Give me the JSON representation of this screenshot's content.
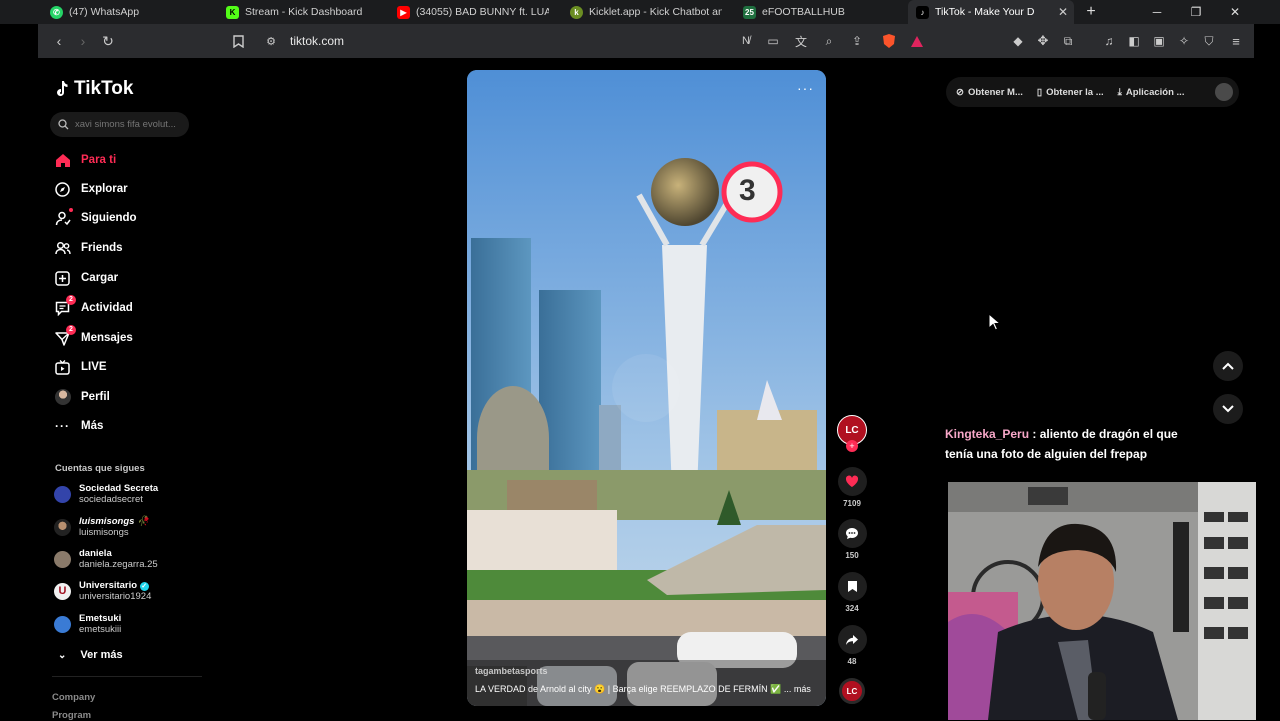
{
  "browser": {
    "tabs": [
      {
        "title": "(47) WhatsApp",
        "icon": "whatsapp-icon",
        "color": "#25d366"
      },
      {
        "title": "Stream - Kick Dashboard",
        "icon": "kick-icon",
        "color": "#53fc18"
      },
      {
        "title": "(34055) BAD BUNNY ft. LUAR",
        "icon": "youtube-icon",
        "color": "#ff0000"
      },
      {
        "title": "Kicklet.app - Kick Chatbot an",
        "icon": "kicklet-icon",
        "color": "#6b8e23"
      },
      {
        "title": "eFOOTBALLHUB",
        "icon": "efootballhub-icon",
        "color": "#1f6f3f",
        "glyph": "25"
      },
      {
        "title": "TikTok - Make Your D",
        "icon": "tiktok-icon",
        "color": "#000000"
      }
    ],
    "url": "tiktok.com"
  },
  "sidebar": {
    "logo": "TikTok",
    "search_placeholder": "xavi simons fifa evolut...",
    "nav": [
      {
        "label": "Para ti",
        "icon": "home-icon",
        "active": true
      },
      {
        "label": "Explorar",
        "icon": "compass-icon"
      },
      {
        "label": "Siguiendo",
        "icon": "following-icon"
      },
      {
        "label": "Friends",
        "icon": "friends-icon"
      },
      {
        "label": "Cargar",
        "icon": "upload-icon"
      },
      {
        "label": "Actividad",
        "icon": "activity-icon",
        "badge": "2"
      },
      {
        "label": "Mensajes",
        "icon": "messages-icon",
        "badge": "2"
      },
      {
        "label": "LIVE",
        "icon": "live-icon"
      },
      {
        "label": "Perfil",
        "icon": "profile-avatar"
      },
      {
        "label": "Más",
        "icon": "more-icon"
      }
    ],
    "following_title": "Cuentas que sigues",
    "following": [
      {
        "name": "Sociedad Secreta",
        "handle": "sociedadsecret",
        "color": "#3344aa"
      },
      {
        "name": "luismisongs 🥀",
        "handle": "luismisongs",
        "color": "#222222"
      },
      {
        "name": "daniela",
        "handle": "daniela.zegarra.25",
        "color": "#8a7a6a"
      },
      {
        "name": "Universitario",
        "handle": "universitario1924",
        "color": "#f0f0f0",
        "verified": true
      },
      {
        "name": "Emetsuki",
        "handle": "emetsukiii",
        "color": "#3a7bd5"
      }
    ],
    "see_more": "Ver más",
    "footer": [
      "Company",
      "Program"
    ]
  },
  "video": {
    "username": "tagambetasports",
    "description": "LA VERDAD de Arnold al city 😮 | Barça elige REEMPLAZO DE FERMÍN ✅ ... más",
    "badge_number": "3"
  },
  "actions": [
    {
      "name": "like",
      "icon": "heart-icon",
      "count": "7109"
    },
    {
      "name": "comment",
      "icon": "comment-icon",
      "count": "150"
    },
    {
      "name": "save",
      "icon": "bookmark-icon",
      "count": "324"
    },
    {
      "name": "share",
      "icon": "share-icon",
      "count": "48"
    }
  ],
  "topbar": {
    "items": [
      "Obtener M...",
      "Obtener la ...",
      "Aplicación ..."
    ]
  },
  "chat": {
    "user": "Kingteka_Peru",
    "message": "aliento de dragón el que tenía una foto de alguien del frepap"
  },
  "colors": {
    "accent": "#fe2c55",
    "chat_user": "#f7a7c8"
  }
}
